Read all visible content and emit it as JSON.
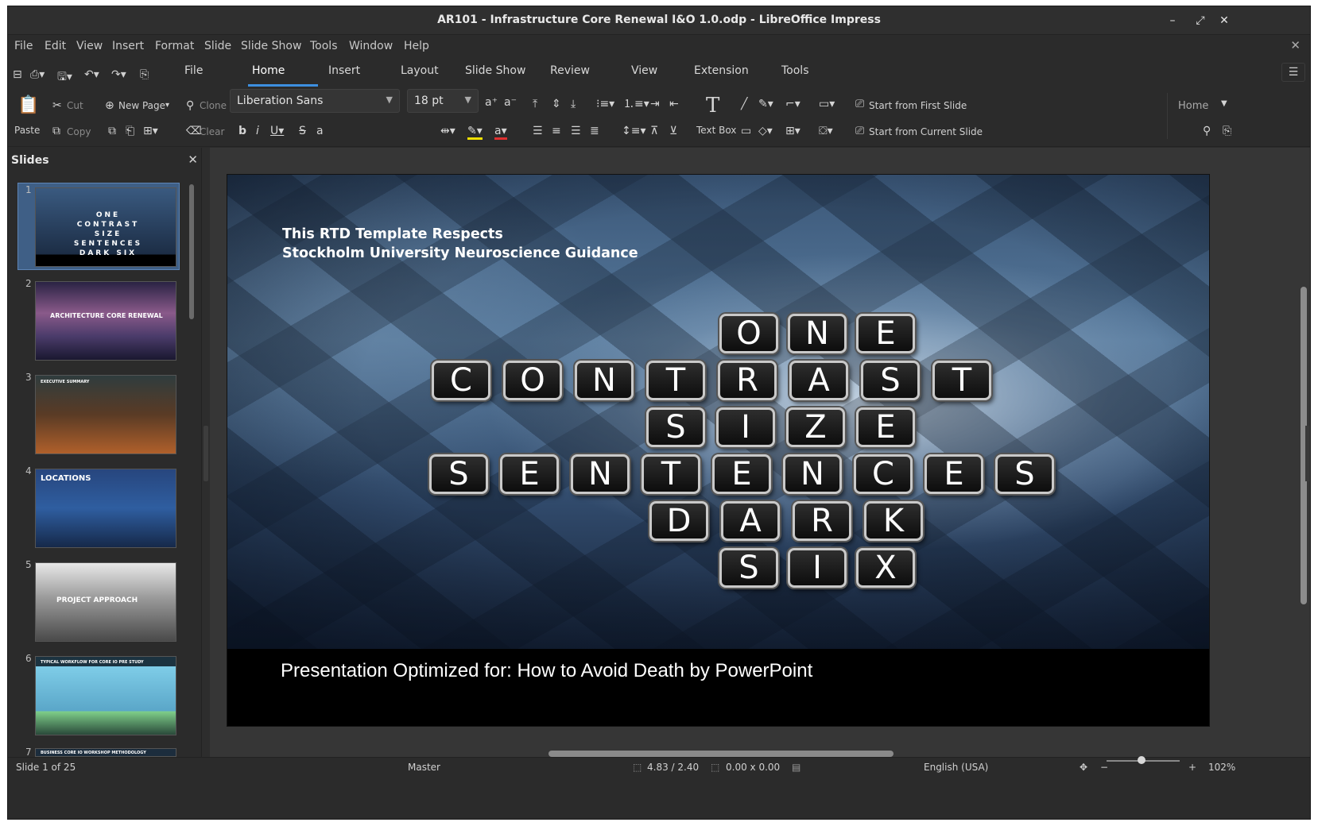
{
  "window": {
    "title": "AR101 - Infrastructure Core Renewal I&O 1.0.odp - LibreOffice Impress",
    "minimize_glyph": "–",
    "maximize_glyph": "⤢",
    "close_glyph": "✕"
  },
  "menu": [
    "File",
    "Edit",
    "View",
    "Insert",
    "Format",
    "Slide",
    "Slide Show",
    "Tools",
    "Window",
    "Help"
  ],
  "tabs": [
    "File",
    "Home",
    "Insert",
    "Layout",
    "Slide Show",
    "Review",
    "View",
    "Extension",
    "Tools"
  ],
  "active_tab": "Home",
  "ribbon": {
    "paste": "Paste",
    "cut": "Cut",
    "copy": "Copy",
    "new_page": "New Page",
    "clone": "Clone",
    "clear": "Clear",
    "font_name": "Liberation Sans",
    "font_size": "18 pt",
    "text_box": "Text Box",
    "start_first": "Start from First Slide",
    "start_current": "Start from Current Slide",
    "sidebar_deck": "Home"
  },
  "slides_panel": {
    "title": "Slides",
    "thumbnails": [
      {
        "num": "1",
        "label": "ONE CONTRAST SIZE SENTENCES DARK SIX"
      },
      {
        "num": "2",
        "label": "ARCHITECTURE CORE RENEWAL"
      },
      {
        "num": "3",
        "label": "EXECUTIVE SUMMARY"
      },
      {
        "num": "4",
        "label": "LOCATIONS"
      },
      {
        "num": "5",
        "label": "PROJECT APPROACH"
      },
      {
        "num": "6",
        "label": "TYPICAL WORKFLOW FOR CORE IO PRE STUDY"
      },
      {
        "num": "7",
        "label": "BUSINESS CORE IO WORKSHOP METHODOLOGY"
      }
    ]
  },
  "slide": {
    "heading_line1": "This RTD Template Respects",
    "heading_line2": "Stockholm University Neuroscience Guidance",
    "subtitle": "Presentation Optimized for: How to Avoid Death by PowerPoint",
    "words": [
      {
        "word": "ONE",
        "letters": [
          "O",
          "N",
          "E"
        ]
      },
      {
        "word": "CONTRAST",
        "letters": [
          "C",
          "O",
          "N",
          "T",
          "R",
          "A",
          "S",
          "T"
        ]
      },
      {
        "word": "SIZE",
        "letters": [
          "S",
          "I",
          "Z",
          "E"
        ]
      },
      {
        "word": "SENTENCES",
        "letters": [
          "S",
          "E",
          "N",
          "T",
          "E",
          "N",
          "C",
          "E",
          "S"
        ]
      },
      {
        "word": "DARK",
        "letters": [
          "D",
          "A",
          "R",
          "K"
        ]
      },
      {
        "word": "SIX",
        "letters": [
          "S",
          "I",
          "X"
        ]
      }
    ]
  },
  "status": {
    "slide_info": "Slide 1 of 25",
    "master": "Master",
    "position": "4.83 / 2.40",
    "size": "0.00 x 0.00",
    "language": "English (USA)",
    "zoom": "102%"
  }
}
